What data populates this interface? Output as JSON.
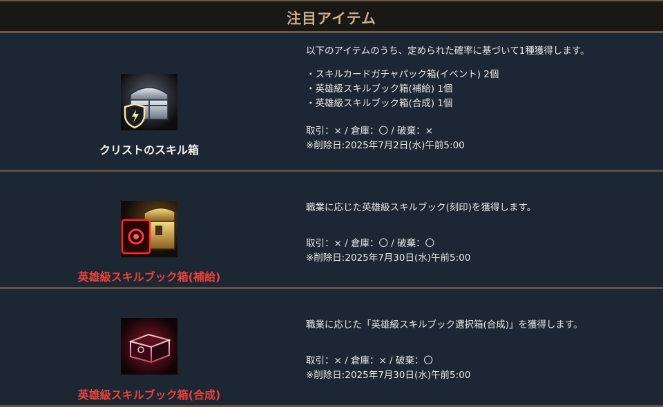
{
  "header": {
    "title": "注目アイテム"
  },
  "items": [
    {
      "name": "クリストのスキル箱",
      "icon": "silver-chest-shield-icon",
      "name_color": "#f0f0f0",
      "desc_intro": "以下のアイテムのうち、定められた確率に基づいて1種獲得します。",
      "contents": [
        "・スキルカードガチャパック箱(イベント) 2個",
        "・英雄級スキルブック箱(補給) 1個",
        "・英雄級スキルブック箱(合成) 1個"
      ],
      "trade": "取引：× / 倉庫：〇 / 破棄：×",
      "delete_date": "※削除日:2025年7月2日(水)午前5:00"
    },
    {
      "name": "英雄級スキルブック箱(補給)",
      "icon": "gold-chest-red-book-icon",
      "name_color": "#e8413a",
      "desc_intro": "職業に応じた英雄級スキルブック(刻印)を獲得します。",
      "trade": "取引：× / 倉庫：〇 / 破棄：〇",
      "delete_date": "※削除日:2025年7月30日(水)午前5:00"
    },
    {
      "name": "英雄級スキルブック箱(合成)",
      "icon": "red-glowing-chest-icon",
      "name_color": "#e8413a",
      "desc_intro": "職業に応じた「英雄級スキルブック選択箱(合成)」を獲得します。",
      "trade": "取引：× / 倉庫：× / 破棄：〇",
      "delete_date": "※削除日:2025年7月30日(水)午前5:00"
    }
  ]
}
